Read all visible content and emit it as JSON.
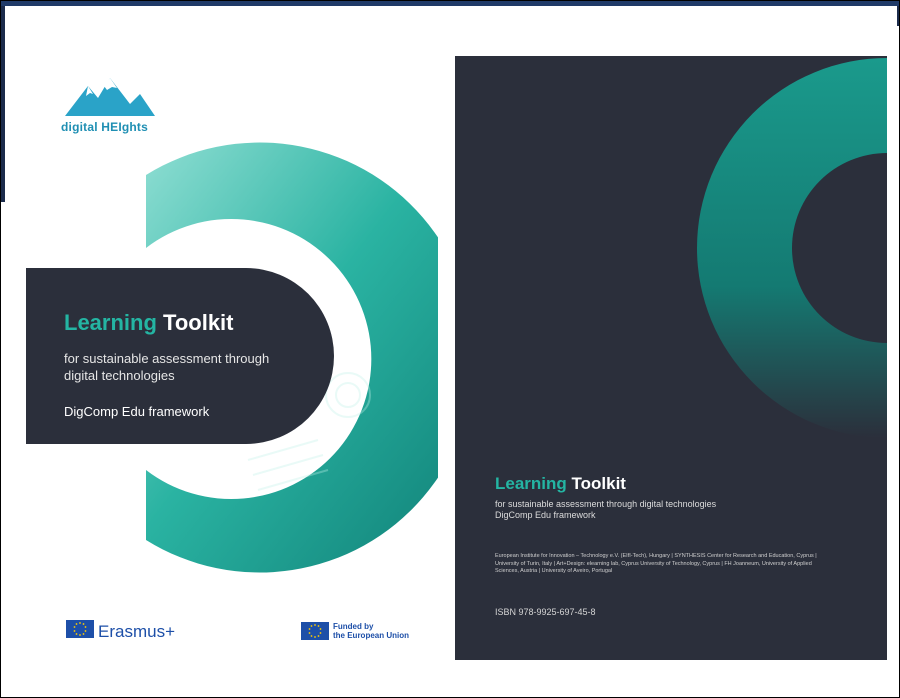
{
  "front_cover": {
    "logo_text": "digital HEIghts",
    "title_accent": "Learning",
    "title_rest": " Toolkit",
    "subtitle": "for sustainable assessment through digital technologies",
    "framework": "DigComp Edu framework",
    "erasmus_label": "Erasmus+",
    "funded_label_line1": "Funded by",
    "funded_label_line2": "the European Union",
    "colors": {
      "accent": "#24b5a3",
      "panel": "#2b2f3b",
      "eu_blue": "#1d4fa8"
    }
  },
  "back_cover": {
    "title_accent": "Learning",
    "title_rest": " Toolkit",
    "subtitle_line1": "for sustainable assessment through digital technologies",
    "subtitle_line2": "DigComp Edu framework",
    "partners": "European Institute for Innovation – Technology e.V. (EIfI-Tech), Hungary | SYNTHESIS Center for Research and Education, Cyprus | University of Turin, Italy | Art+Design: elearning lab, Cyprus University of Technology, Cyprus | FH Joanneum, University of Applied Sciences, Austria | University of Aveiro, Portugal",
    "isbn": "ISBN 978-9925-697-45-8"
  }
}
